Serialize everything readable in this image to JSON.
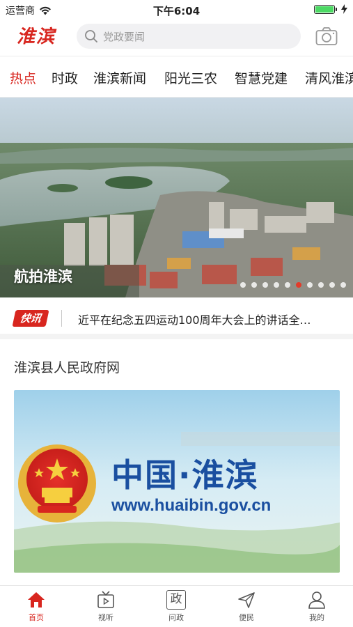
{
  "status_bar": {
    "carrier": "运营商",
    "time": "下午6:04"
  },
  "header": {
    "logo": "淮滨",
    "search_placeholder": "党政要闻"
  },
  "tabs": [
    {
      "label": "热点",
      "active": true
    },
    {
      "label": "时政"
    },
    {
      "label": "淮滨新闻"
    },
    {
      "label": "阳光三农"
    },
    {
      "label": "智慧党建"
    },
    {
      "label": "清风淮滨"
    }
  ],
  "banner": {
    "caption": "航拍淮滨",
    "dot_count": 10,
    "active_dot": 5
  },
  "ticker": {
    "badge": "快讯",
    "text": "近平在纪念五四运动100周年大会上的讲话全…"
  },
  "section": {
    "title": "淮滨县人民政府网",
    "card_title": "中国·淮滨",
    "card_url": "www.huaibin.gov.cn"
  },
  "bottom_nav": [
    {
      "label": "首页",
      "icon": "home-icon",
      "active": true
    },
    {
      "label": "视听",
      "icon": "tv-icon"
    },
    {
      "label": "问政",
      "icon": "zheng-icon",
      "glyph": "政"
    },
    {
      "label": "便民",
      "icon": "send-icon"
    },
    {
      "label": "我的",
      "icon": "user-icon"
    }
  ],
  "colors": {
    "accent": "#d8261f",
    "link_blue": "#1a4fa0"
  }
}
